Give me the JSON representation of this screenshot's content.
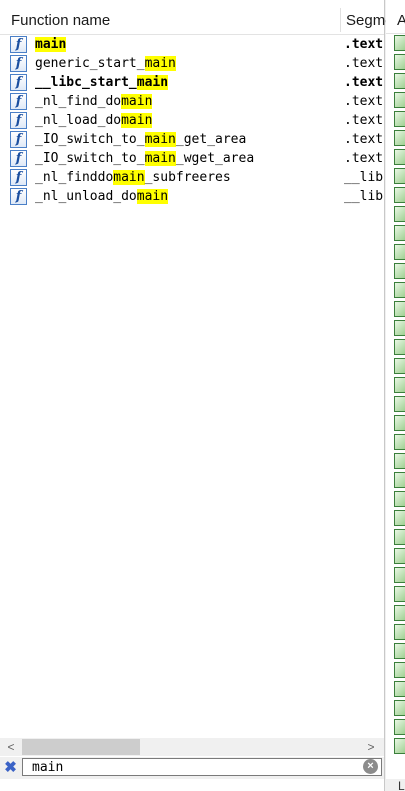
{
  "header": {
    "function_name": "Function name",
    "segment": "Segment"
  },
  "functions": [
    {
      "icon": "f",
      "prefix": "",
      "match": "main",
      "suffix": "",
      "bold": true,
      "segment": ".text"
    },
    {
      "icon": "f",
      "prefix": "generic_start_",
      "match": "main",
      "suffix": "",
      "bold": false,
      "segment": ".text"
    },
    {
      "icon": "f",
      "prefix": "__libc_start_",
      "match": "main",
      "suffix": "",
      "bold": true,
      "segment": ".text"
    },
    {
      "icon": "f",
      "prefix": "_nl_find_do",
      "match": "main",
      "suffix": "",
      "bold": false,
      "segment": ".text"
    },
    {
      "icon": "f",
      "prefix": "_nl_load_do",
      "match": "main",
      "suffix": "",
      "bold": false,
      "segment": ".text"
    },
    {
      "icon": "f",
      "prefix": "_IO_switch_to_",
      "match": "main",
      "suffix": "_get_area",
      "bold": false,
      "segment": ".text"
    },
    {
      "icon": "f",
      "prefix": "_IO_switch_to_",
      "match": "main",
      "suffix": "_wget_area",
      "bold": false,
      "segment": ".text"
    },
    {
      "icon": "f",
      "prefix": "_nl_finddo",
      "match": "main",
      "suffix": "_subfreeres",
      "bold": false,
      "segment": "__libc"
    },
    {
      "icon": "f",
      "prefix": "_nl_unload_do",
      "match": "main",
      "suffix": "",
      "bold": false,
      "segment": "__libc"
    }
  ],
  "scrollbar": {
    "left_arrow": "<",
    "right_arrow": ">"
  },
  "filter": {
    "value": "main",
    "clear_left_icon": "✖",
    "clear_right_icon": "×"
  },
  "side_panel": {
    "header": "A",
    "bottom_label": "Li"
  },
  "colors": {
    "highlight": "#ffff00",
    "function_icon_border": "#4a7fc7"
  }
}
